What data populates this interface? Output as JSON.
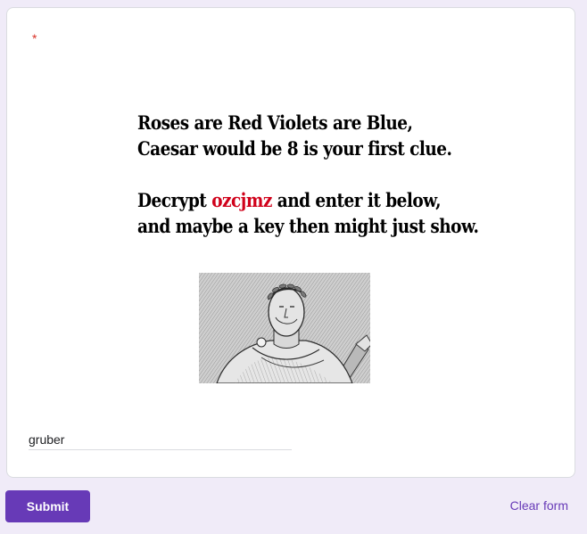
{
  "question": {
    "required_marker": "*",
    "poem": {
      "line1": "Roses are Red Violets are Blue,",
      "line2": "Caesar would be 8 is your first clue.",
      "line3_prefix": "Decrypt ",
      "cipher_word": "ozcjmz",
      "line3_suffix": " and enter it below,",
      "line4": "and maybe a key then might just show."
    },
    "image": {
      "icon": "caesar-portrait-engraving"
    },
    "answer": {
      "value": "gruber"
    }
  },
  "footer": {
    "submit_label": "Submit",
    "clear_label": "Clear form"
  },
  "colors": {
    "accent": "#673ab7",
    "background": "#f0ebf8",
    "cipher": "#d0021b",
    "required": "#d93025"
  }
}
